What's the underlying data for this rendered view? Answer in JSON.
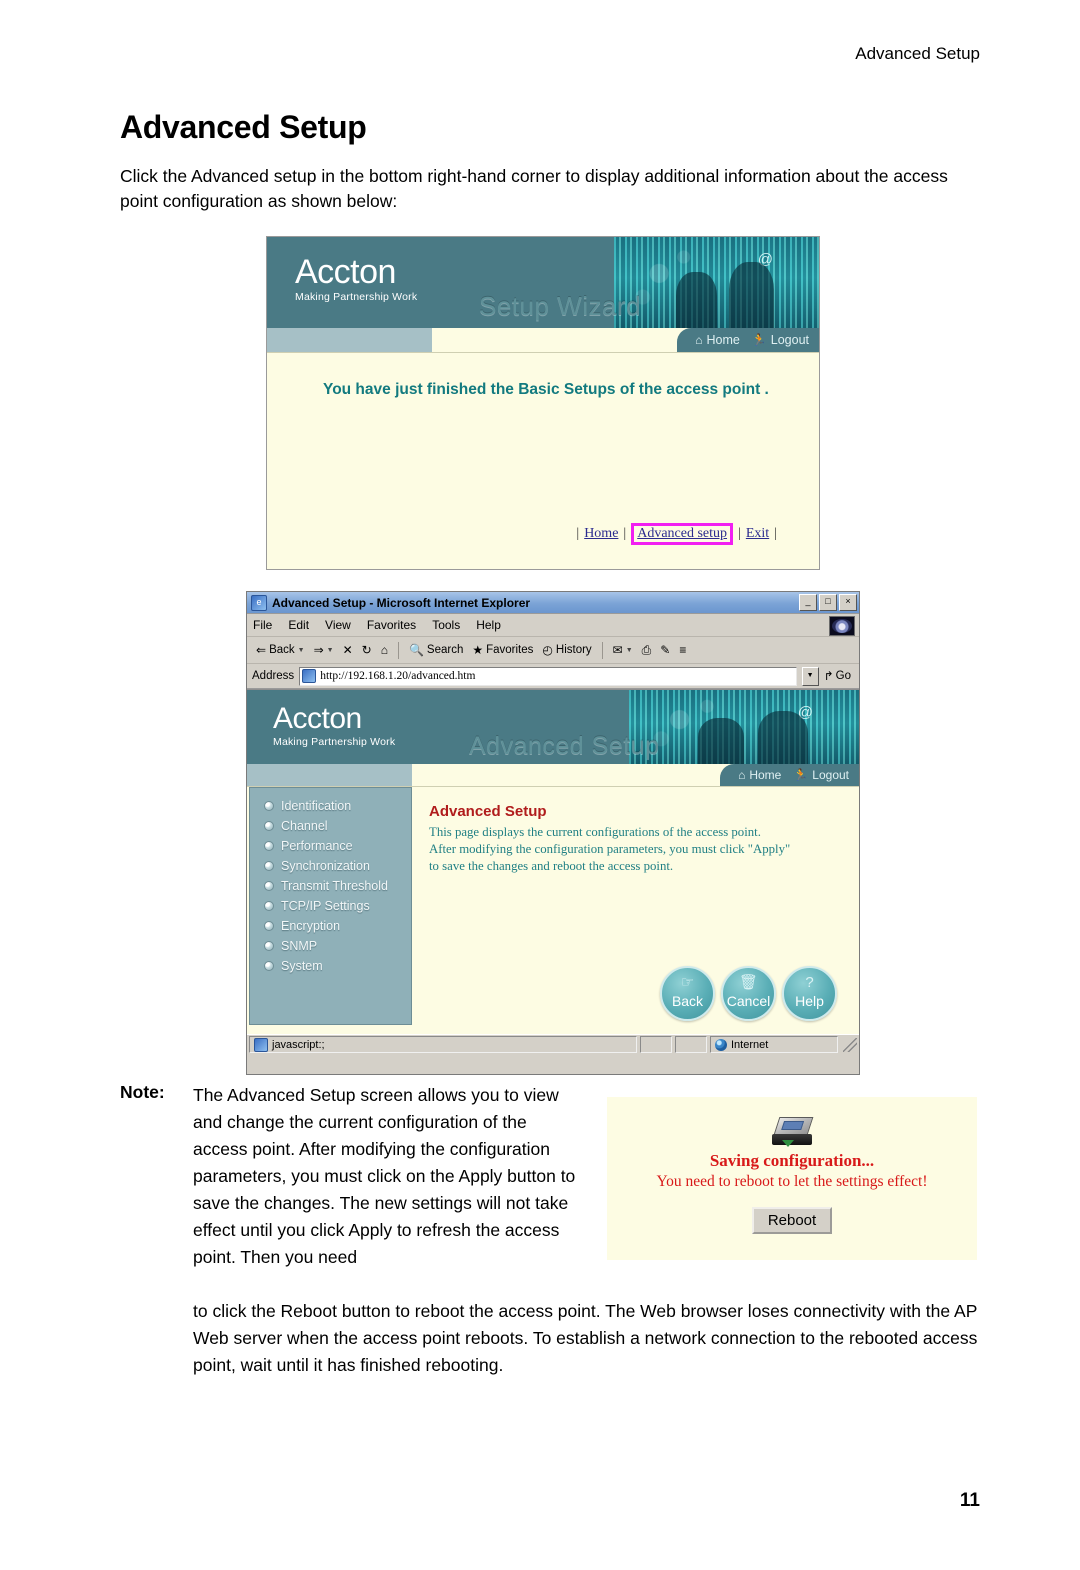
{
  "page": {
    "running_head": "Advanced Setup",
    "title": "Advanced Setup",
    "intro": "Click the Advanced setup in the bottom right-hand corner to display additional information about the access point configuration as shown below:",
    "number": "11"
  },
  "colors": {
    "banner_teal": "#4a7a85",
    "page_cream": "#fdfce3",
    "sidebar_blue": "#8fb0b8",
    "heading_red": "#b01c1c",
    "body_teal": "#1f7f84",
    "alert_red": "#d81919",
    "highlight_magenta": "#f11ff1"
  },
  "wizard_shot": {
    "logo_name": "Accton",
    "logo_tagline": "Making Partnership Work",
    "banner_title": "Setup Wizard",
    "at_symbol": "@",
    "nav": [
      {
        "label": "Home",
        "icon": "home-icon",
        "glyph": "⌂"
      },
      {
        "label": "Logout",
        "icon": "logout-runner-icon",
        "glyph": "Ἴ3"
      }
    ],
    "message": "You have just finished the Basic Setups of the access point .",
    "links": {
      "open_bar": "|",
      "home": "Home",
      "mid_bar": "|",
      "advanced_setup": "Advanced setup",
      "mid_bar2": "|",
      "exit": "Exit",
      "close_bar": "|"
    }
  },
  "browser_shot": {
    "window_title": "Advanced Setup - Microsoft Internet Explorer",
    "window_buttons": [
      {
        "name": "minimize-button",
        "glyph": "_"
      },
      {
        "name": "maximize-button",
        "glyph": "□"
      },
      {
        "name": "close-button",
        "glyph": "×"
      }
    ],
    "menus": [
      "File",
      "Edit",
      "View",
      "Favorites",
      "Tools",
      "Help"
    ],
    "toolbar": [
      {
        "label": "Back",
        "icon": "back-arrow-icon",
        "glyph": "⇐",
        "has_caret": true
      },
      {
        "label": "",
        "icon": "forward-arrow-icon",
        "glyph": "⇒",
        "has_caret": true
      },
      {
        "label": "",
        "icon": "stop-icon",
        "glyph": "✕"
      },
      {
        "label": "",
        "icon": "refresh-icon",
        "glyph": "↻"
      },
      {
        "label": "",
        "icon": "home-icon",
        "glyph": "⌂"
      },
      {
        "label": "Search",
        "icon": "search-icon",
        "glyph": "◌"
      },
      {
        "label": "Favorites",
        "icon": "favorites-star-icon",
        "glyph": "★"
      },
      {
        "label": "History",
        "icon": "history-clock-icon",
        "glyph": "◴"
      },
      {
        "label": "",
        "icon": "mail-dropdown-icon",
        "glyph": "✉",
        "has_caret": true
      },
      {
        "label": "",
        "icon": "print-icon",
        "glyph": "⎙"
      },
      {
        "label": "",
        "icon": "edit-icon",
        "glyph": "✎"
      },
      {
        "label": "",
        "icon": "discuss-icon",
        "glyph": "≡"
      }
    ],
    "address": {
      "label": "Address",
      "value": "http://192.168.1.20/advanced.htm",
      "go_label": "Go"
    },
    "page": {
      "logo_name": "Accton",
      "logo_tagline": "Making Partnership Work",
      "banner_title": "Advanced Setup",
      "at_symbol": "@",
      "nav": [
        {
          "label": "Home",
          "icon": "home-icon",
          "glyph": "⌂"
        },
        {
          "label": "Logout",
          "icon": "logout-runner-icon",
          "glyph": "Ἴ3"
        }
      ],
      "sidebar": [
        "Identification",
        "Channel",
        "Performance",
        "Synchronization",
        "Transmit Threshold",
        "TCP/IP Settings",
        "Encryption",
        "SNMP",
        "System"
      ],
      "heading": "Advanced Setup",
      "description_lines": [
        "This page displays the current configurations of the access point.",
        "After modifying the configuration parameters, you must click \"Apply\"",
        "to save the changes and reboot the access point."
      ],
      "buttons": [
        {
          "label": "Back",
          "icon": "pointing-hand-icon",
          "glyph": "☞"
        },
        {
          "label": "Cancel",
          "icon": "trash-can-icon",
          "glyph": "Ὕ1"
        },
        {
          "label": "Help",
          "icon": "question-mark-icon",
          "glyph": "?"
        }
      ]
    },
    "statusbar": {
      "message": "javascript:;",
      "zone": "Internet",
      "zone_icon": "internet-globe-icon"
    }
  },
  "note": {
    "label": "Note:",
    "body": "The Advanced Setup screen allows you to view and change the current configuration of the access point. After modifying the configuration parameters, you must click on the Apply button to save the changes. The new settings will not take effect until you click Apply to refresh the access point. Then you need",
    "tail": "to click the Reboot button to reboot the access point. The Web browser loses connectivity with the AP Web server when the access point reboots. To establish a network connection to the rebooted access point, wait until it has finished rebooting."
  },
  "saving_box": {
    "icon": "save-to-disk-icon",
    "heading": "Saving configuration...",
    "message": "You need to reboot to let the settings effect!",
    "button_label": "Reboot"
  }
}
